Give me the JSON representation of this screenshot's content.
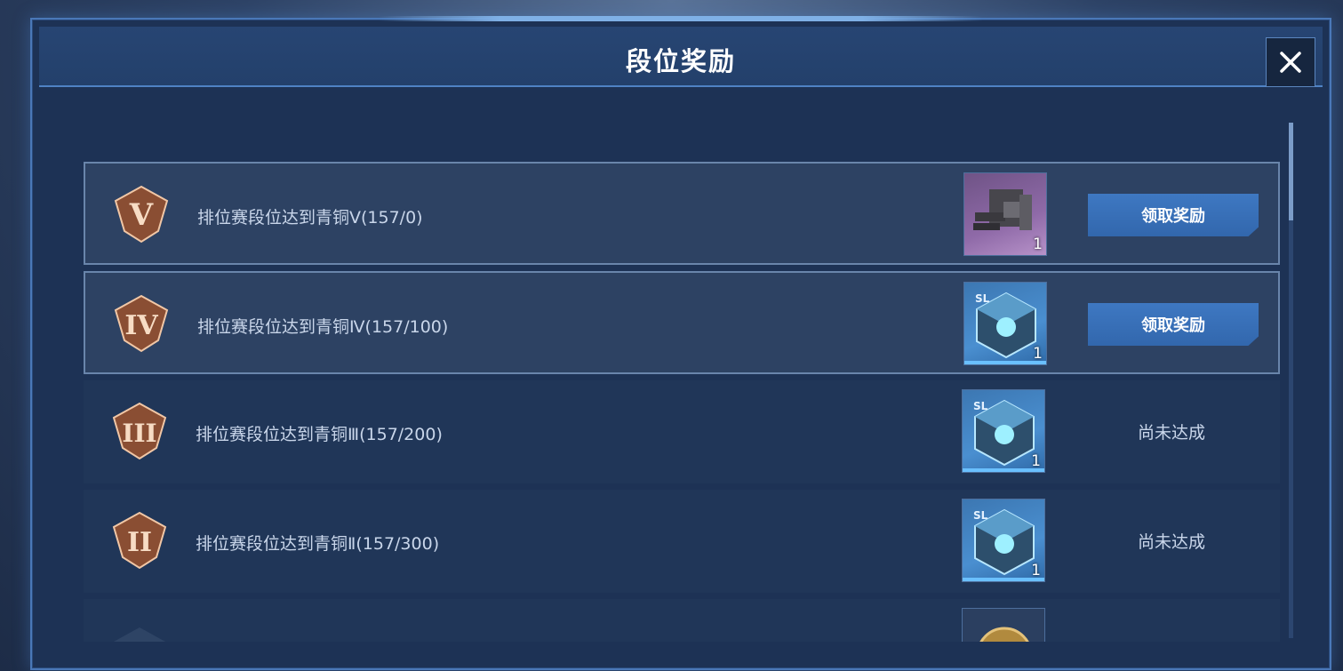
{
  "dialog": {
    "title": "段位奖励",
    "close_icon": "close-icon"
  },
  "rewards": [
    {
      "text": "排位赛段位达到青铜Ⅴ(157/0)",
      "rank_icon": "bronze-v-badge-icon",
      "item_icon": "weapon-part-icon",
      "quantity": "1",
      "action": "领取奖励",
      "state": "claimable"
    },
    {
      "text": "排位赛段位达到青铜Ⅳ(157/100)",
      "rank_icon": "bronze-iv-badge-icon",
      "item_icon": "crystal-cube-icon",
      "quantity": "1",
      "action": "领取奖励",
      "state": "claimable"
    },
    {
      "text": "排位赛段位达到青铜Ⅲ(157/200)",
      "rank_icon": "bronze-iii-badge-icon",
      "item_icon": "crystal-cube-icon",
      "quantity": "1",
      "status": "尚未达成",
      "state": "locked"
    },
    {
      "text": "排位赛段位达到青铜Ⅱ(157/300)",
      "rank_icon": "bronze-ii-badge-icon",
      "item_icon": "crystal-cube-icon",
      "quantity": "1",
      "status": "尚未达成",
      "state": "locked"
    }
  ],
  "colors": {
    "panel_bg": "#1d3255",
    "button": "#3a72bb",
    "text": "#c9d6ea",
    "bronze": "#c8794e"
  }
}
